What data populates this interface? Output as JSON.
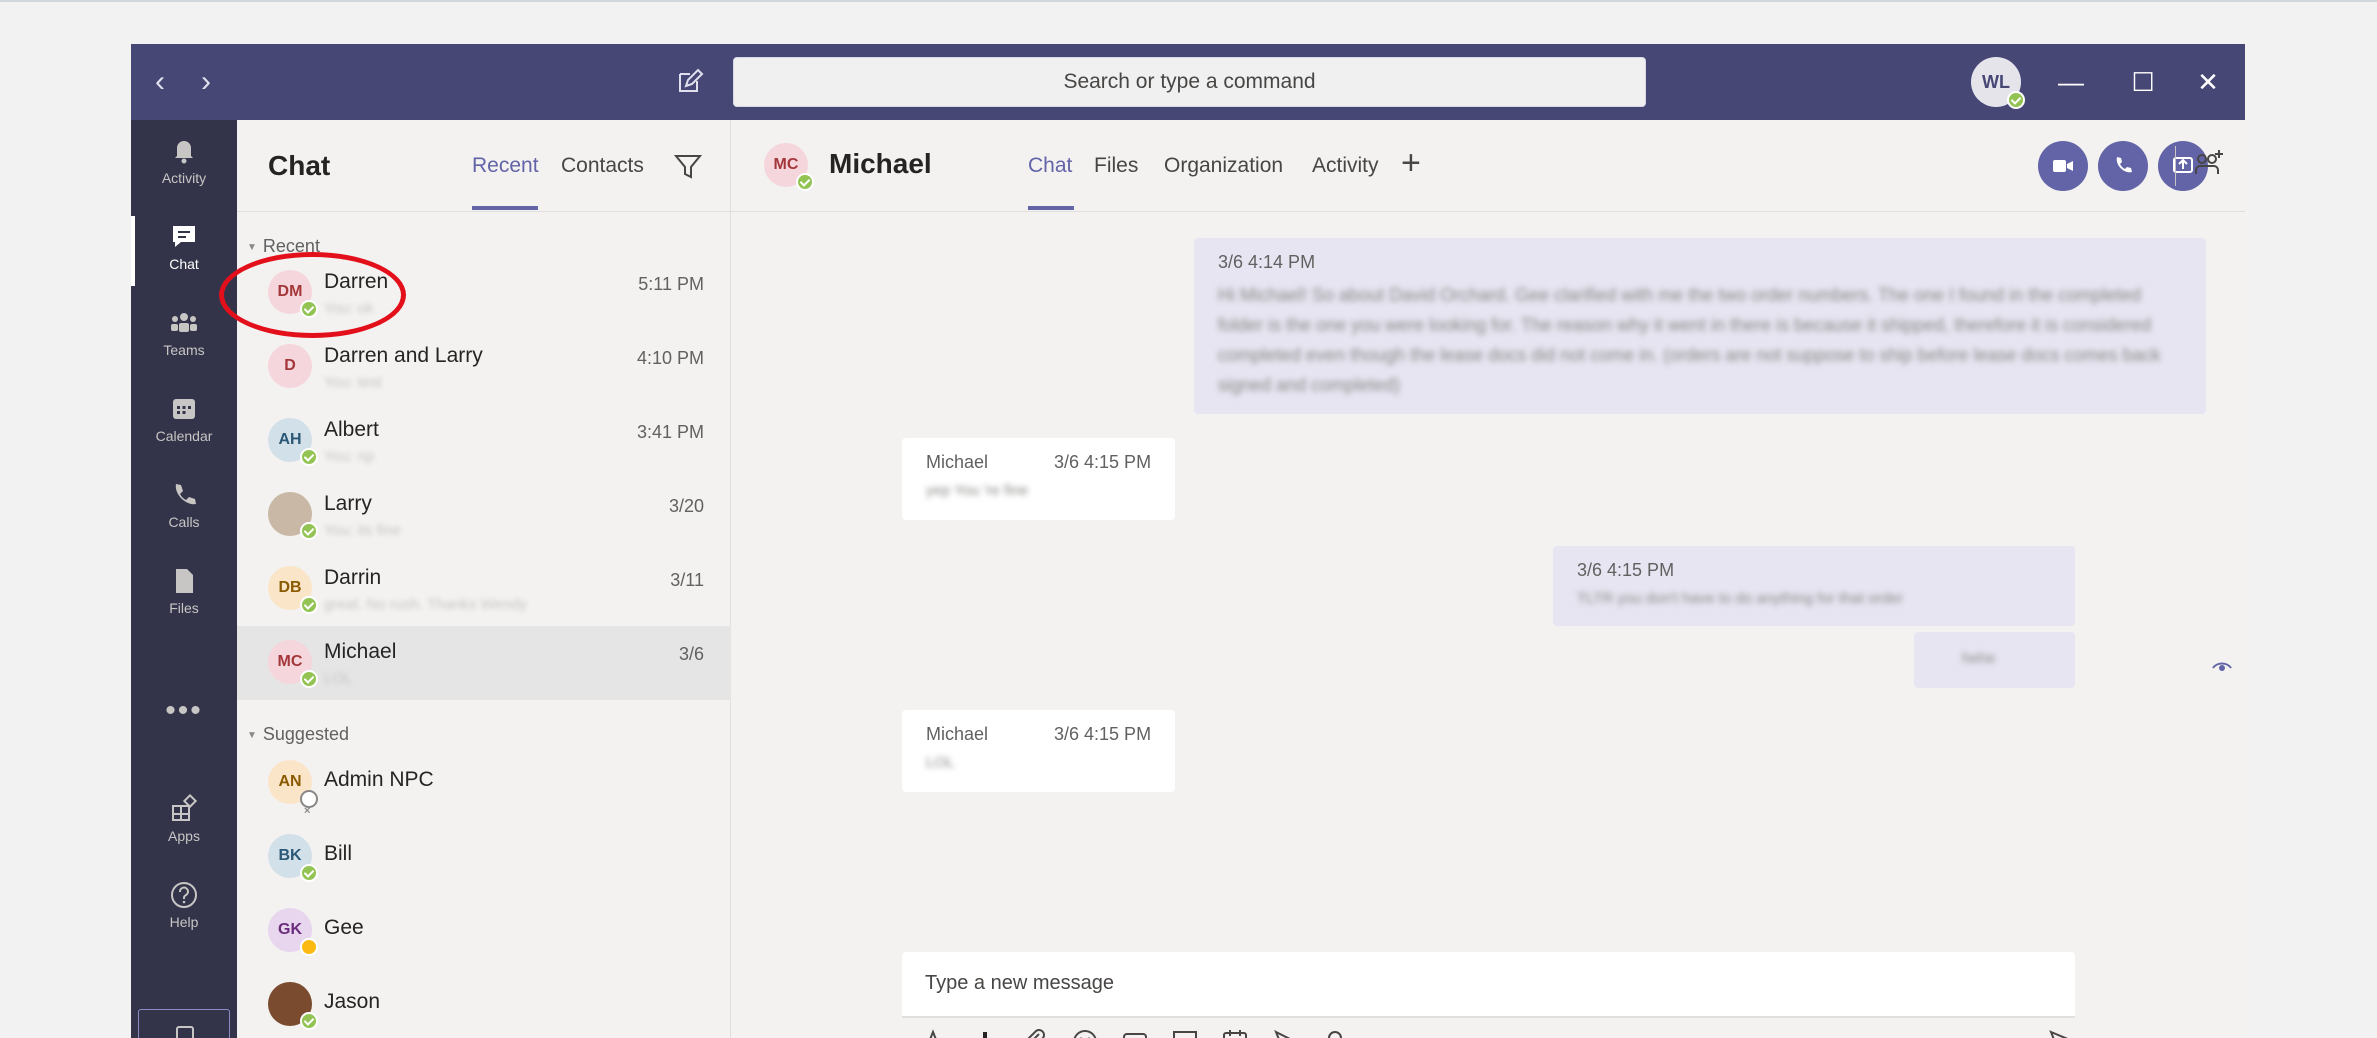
{
  "titlebar": {
    "search_placeholder": "Search or type a command",
    "user_initials": "WL",
    "back_glyph": "‹",
    "forward_glyph": "›",
    "minimize_glyph": "—",
    "maximize_glyph": "☐",
    "close_glyph": "✕"
  },
  "rail": {
    "items": [
      {
        "label": "Activity",
        "icon": "bell-icon"
      },
      {
        "label": "Chat",
        "icon": "chat-icon"
      },
      {
        "label": "Teams",
        "icon": "teams-icon"
      },
      {
        "label": "Calendar",
        "icon": "calendar-icon"
      },
      {
        "label": "Calls",
        "icon": "phone-icon"
      },
      {
        "label": "Files",
        "icon": "files-icon"
      },
      {
        "label": "Apps",
        "icon": "apps-icon"
      },
      {
        "label": "Help",
        "icon": "help-icon"
      }
    ],
    "more_glyph": "•••"
  },
  "chatlist": {
    "title": "Chat",
    "tabs": [
      "Recent",
      "Contacts"
    ],
    "sections": {
      "recent": "Recent",
      "suggested": "Suggested"
    },
    "recent": [
      {
        "initials": "DM",
        "name": "Darren",
        "time": "5:11 PM",
        "preview": "You: ok",
        "avatar_bg": "#f5d6dc",
        "avatar_fg": "#a4373a",
        "presence": "available"
      },
      {
        "initials": "D",
        "name": "Darren and Larry",
        "time": "4:10 PM",
        "preview": "You: test",
        "avatar_bg": "#f5d6dc",
        "avatar_fg": "#a4373a",
        "presence": "none"
      },
      {
        "initials": "AH",
        "name": "Albert",
        "time": "3:41 PM",
        "preview": "You: np",
        "avatar_bg": "#d2e0ea",
        "avatar_fg": "#2b5876",
        "presence": "available"
      },
      {
        "initials": "",
        "name": "Larry",
        "time": "3/20",
        "preview": "You: its fine",
        "avatar_bg": "#c9b8a6",
        "avatar_fg": "#5a4636",
        "presence": "available"
      },
      {
        "initials": "DB",
        "name": "Darrin",
        "time": "3/11",
        "preview": "great. No rush. Thanks Wendy",
        "avatar_bg": "#fbe5c8",
        "avatar_fg": "#8a5a00",
        "presence": "available"
      },
      {
        "initials": "MC",
        "name": "Michael",
        "time": "3/6",
        "preview": "LOL",
        "avatar_bg": "#f5d6dc",
        "avatar_fg": "#a4373a",
        "presence": "available"
      }
    ],
    "suggested": [
      {
        "initials": "AN",
        "name": "Admin NPC",
        "avatar_bg": "#fbe5c8",
        "avatar_fg": "#8a5a00",
        "presence": "offline"
      },
      {
        "initials": "BK",
        "name": "Bill",
        "avatar_bg": "#d2e0ea",
        "avatar_fg": "#2b5876",
        "presence": "available"
      },
      {
        "initials": "GK",
        "name": "Gee",
        "avatar_bg": "#e8d5ee",
        "avatar_fg": "#6b2c7c",
        "presence": "away"
      },
      {
        "initials": "",
        "name": "Jason",
        "avatar_bg": "#7a4b2e",
        "avatar_fg": "#ffffff",
        "presence": "available"
      }
    ]
  },
  "conversation": {
    "initials": "MC",
    "name": "Michael",
    "tabs": [
      "Chat",
      "Files",
      "Organization",
      "Activity"
    ],
    "add_tab_glyph": "+",
    "messages": [
      {
        "from": "me",
        "time": "3/6 4:14 PM",
        "text": "Hi Michael! So about David Orchard. Gee clarified with me the two order numbers. The one I found in the completed folder is the one you were looking for. The reason why it went in there is because it shipped, therefore it is considered completed even though the lease docs did not come in. (orders are not suppose to ship before lease docs comes back signed and completed)"
      },
      {
        "from": "them",
        "sender": "Michael",
        "time": "3/6 4:15 PM",
        "text": "yep You 're fine"
      },
      {
        "from": "me",
        "time": "3/6 4:15 PM",
        "text": "TLTR you don't have to do anything for that order"
      },
      {
        "from": "me",
        "time": "",
        "text": "hehe"
      },
      {
        "from": "them",
        "sender": "Michael",
        "time": "3/6 4:15 PM",
        "text": "LOL"
      }
    ],
    "compose_placeholder": "Type a new message",
    "toolbar": [
      "format-icon",
      "important-icon",
      "attach-icon",
      "emoji-icon",
      "gif-icon",
      "sticker-icon",
      "meeting-icon",
      "stream-icon",
      "praise-icon",
      "more-icon"
    ]
  },
  "colors": {
    "titlebar": "#464775",
    "rail": "#33344a",
    "accent": "#6264a7",
    "available": "#92c353",
    "annotation": "#e3101b"
  }
}
